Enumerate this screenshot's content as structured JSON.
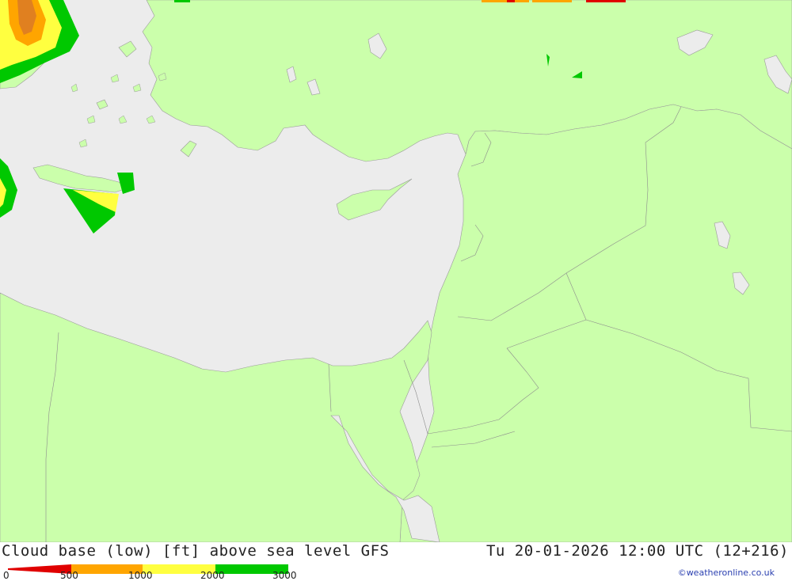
{
  "map": {
    "colors": {
      "sea": "#ececec",
      "land": "#cbffab",
      "cloud_0_500": "#e00000",
      "cloud_500_1000": "#ffa500",
      "cloud_1000_2000": "#ffff40",
      "cloud_2000_3000": "#00c800",
      "cloud_dark_orange": "#e08020"
    }
  },
  "footer": {
    "title": "Cloud base (low) [ft] above sea level GFS",
    "datetime": "Tu 20-01-2026 12:00 UTC (12+216)",
    "credit": "©weatheronline.co.uk",
    "legend": {
      "ticks": [
        "0",
        "500",
        "1000",
        "2000",
        "3000"
      ],
      "colors": [
        "#e00000",
        "#ffa500",
        "#ffff40",
        "#00c800"
      ]
    }
  }
}
